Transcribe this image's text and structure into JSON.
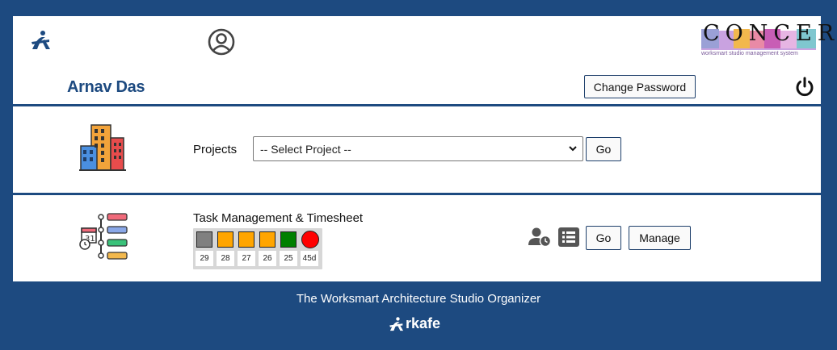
{
  "header": {
    "user_name": "Arnav Das",
    "change_password_label": "Change Password",
    "logo_text": "CONCERT",
    "logo_subtext": "worksmart studio management system",
    "icons": [
      "arkafe-icon",
      "user-circle-icon",
      "power-icon"
    ]
  },
  "projects": {
    "label": "Projects",
    "select_value": "-- Select Project --",
    "go_label": "Go",
    "icon": "buildings-icon"
  },
  "tasks": {
    "title": "Task Management & Timesheet",
    "status_colors": [
      "#808080",
      "#ffa500",
      "#ffa500",
      "#ffa500",
      "#008000",
      "#ff0000"
    ],
    "days": [
      "29",
      "28",
      "27",
      "26",
      "25",
      "45d"
    ],
    "go_label": "Go",
    "manage_label": "Manage",
    "icons": [
      "task-timeline-icon",
      "user-clock-icon",
      "list-icon"
    ]
  },
  "footer": {
    "tagline": "The Worksmart Architecture Studio Organizer",
    "brand": "rkafe"
  }
}
